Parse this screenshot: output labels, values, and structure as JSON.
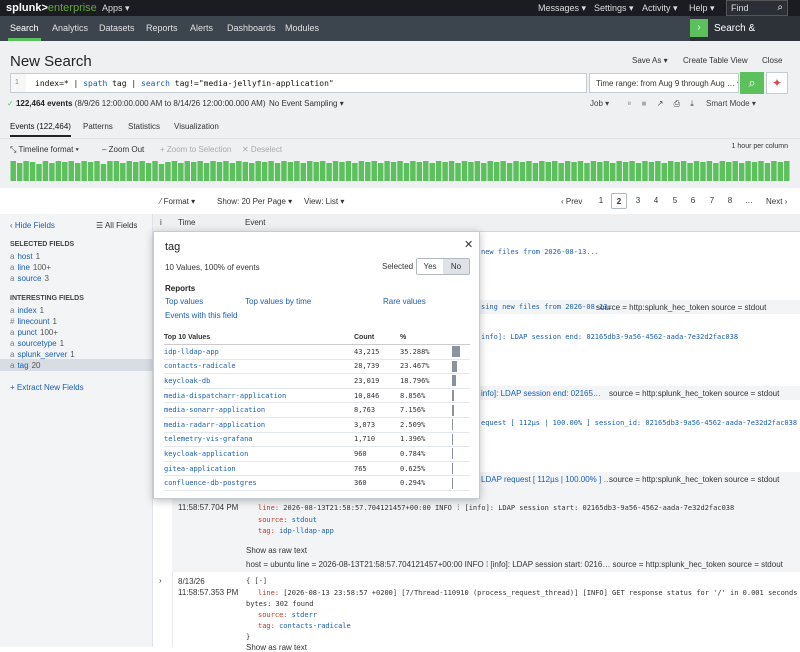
{
  "topbar": {
    "logo_a": "splunk>",
    "logo_b": "enterprise",
    "apps": "Apps ▾",
    "menus": [
      "Messages ▾",
      "Settings ▾",
      "Activity ▾",
      "Help ▾"
    ],
    "find": "Find"
  },
  "nav": {
    "tabs": [
      "Search",
      "Analytics",
      "Datasets",
      "Reports",
      "Alerts",
      "Dashboards",
      "Modules"
    ],
    "app": "Search & Reporting"
  },
  "header": {
    "title": "New Search",
    "buttons": [
      "Save As ▾",
      "Create Table View",
      "Close"
    ]
  },
  "search": {
    "line": "1",
    "query_pre": "index=* |",
    "query_k1": "spath",
    "query_mid": "tag |",
    "query_k2": "search",
    "query_post": "tag!=\"media-jellyfin-application\"",
    "time_range": "Time range: from Aug 9 through Aug … ▾"
  },
  "status": {
    "count": "122,464 events",
    "range": "(8/9/26 12:00:00.000 AM to 8/14/26 12:00:00.000 AM)",
    "sampling": "No Event Sampling ▾",
    "job": "Job ▾",
    "mode": "Smart Mode ▾"
  },
  "tabs": [
    "Events (122,464)",
    "Patterns",
    "Statistics",
    "Visualization"
  ],
  "timeline": {
    "format": "Timeline format ▾",
    "zoom_out": "Zoom Out",
    "zoom_sel": "+ Zoom to Selection",
    "deselect": "✕ Deselect",
    "scale": "1 hour per column",
    "bars": [
      1,
      0.9,
      1,
      0.95,
      0.85,
      1,
      0.9,
      1,
      0.95,
      1,
      0.9,
      1,
      0.95,
      1,
      0.85,
      1,
      1,
      0.9,
      1,
      0.95,
      1,
      0.9,
      1,
      0.85,
      0.95,
      1,
      0.9,
      1,
      0.95,
      1,
      0.9,
      1,
      0.95,
      1,
      0.9,
      1,
      0.95,
      0.9,
      1,
      0.95,
      1,
      0.9,
      1,
      0.95,
      1,
      0.9,
      1,
      0.95,
      1,
      0.9,
      1,
      0.95,
      1,
      0.9,
      1,
      0.95,
      1,
      0.9,
      1,
      0.95,
      1,
      0.9,
      1,
      0.95,
      1,
      0.9,
      1,
      0.95,
      1,
      0.9,
      1,
      0.95,
      1,
      0.9,
      1,
      0.95,
      1,
      0.9,
      1,
      0.95,
      1,
      0.9,
      1,
      0.95,
      1,
      0.9,
      1,
      0.95,
      1,
      0.9,
      1,
      0.95,
      1,
      0.9,
      1,
      0.95,
      1,
      0.9,
      1,
      0.95,
      1,
      0.9,
      1,
      0.95,
      1,
      0.9,
      1,
      0.95,
      1,
      0.9,
      1,
      0.95,
      1,
      0.9,
      1,
      0.95,
      1,
      0.9,
      1,
      0.95,
      1
    ]
  },
  "results": {
    "format": "Format ▾",
    "per_page": "Show: 20 Per Page ▾",
    "view": "View: List ▾",
    "prev": "‹ Prev",
    "pages": [
      "1",
      "2",
      "3",
      "4",
      "5",
      "6",
      "7",
      "8",
      "…"
    ],
    "next": "Next ›"
  },
  "sidebar": {
    "hide": "‹ Hide Fields",
    "all": "☰ All Fields",
    "selected_title": "SELECTED FIELDS",
    "selected": [
      {
        "t": "a",
        "n": "host",
        "c": "1"
      },
      {
        "t": "a",
        "n": "line",
        "c": "100+"
      },
      {
        "t": "a",
        "n": "source",
        "c": "3"
      }
    ],
    "interesting_title": "INTERESTING FIELDS",
    "interesting": [
      {
        "t": "a",
        "n": "index",
        "c": "1"
      },
      {
        "t": "#",
        "n": "linecount",
        "c": "1"
      },
      {
        "t": "a",
        "n": "punct",
        "c": "100+"
      },
      {
        "t": "a",
        "n": "sourcetype",
        "c": "1"
      },
      {
        "t": "a",
        "n": "splunk_server",
        "c": "1"
      },
      {
        "t": "a",
        "n": "tag",
        "c": "20"
      }
    ],
    "extract": "+ Extract New Fields"
  },
  "table": {
    "col_i": "i",
    "col_time": "Time",
    "col_event": "Event"
  },
  "events": {
    "r1_text": "new files from 2026-08-13...",
    "r2_text": "sing new files from 2026-08-13…",
    "r2_meta": "source = http:splunk_hec_token   source = stdout",
    "r3_text": "info]: LDAP session end: 02165db3-9a56-4562-aada-7e32d2fac038",
    "r4_text": "info]: LDAP session end: 02165…",
    "r4_meta": "source = http:splunk_hec_token   source = stdout",
    "r5_text": "equest [ 112µs | 100.00% ] session_id: 02165db3-9a56-4562-aada-7e32d2fac038",
    "r6_text": "LDAP request [ 112µs | 100.00% ] …",
    "r6_meta": "source = http:splunk_hec_token   source = stdout",
    "e1": {
      "time": "11:58:57.704 PM",
      "line_k": "line:",
      "line_v": "2026-08-13T21:58:57.704121457+00:00  INFO     ⁞ [info]: LDAP session start: 02165db3-9a56-4562-aada-7e32d2fac038",
      "source_k": "source:",
      "source_v": "stdout",
      "tag_k": "tag:",
      "tag_v": "idp-lldap-app",
      "raw": "Show as raw text",
      "meta": "host = ubuntu   line = 2026-08-13T21:58:57.704121457+00:00 INFO  ⁞ [info]: LDAP session start: 0216…   source = http:splunk_hec_token   source = stdout"
    },
    "e2": {
      "date": "8/13/26",
      "time": "11:58:57.353 PM",
      "open": "{ [-]",
      "line_k": "line:",
      "line_v": "[2026-08-13 23:58:57 +0200] [7/Thread-110910 (process_request_thread)] [INFO] GET response status for '/' in 0.001 seconds plain 19",
      "line_v2": "bytes: 302 found",
      "source_k": "source:",
      "source_v": "stderr",
      "tag_k": "tag:",
      "tag_v": "contacts-radicale",
      "close": "}",
      "raw": "Show as raw text"
    }
  },
  "popup": {
    "title": "tag",
    "close": "✕",
    "summary": "10 Values, 100% of events",
    "selected_label": "Selected",
    "yes": "Yes",
    "no": "No",
    "reports_title": "Reports",
    "top_values": "Top values",
    "top_by_time": "Top values by time",
    "rare": "Rare values",
    "events_with": "Events with this field",
    "top10": "Top 10 Values",
    "count_h": "Count",
    "pct_h": "%",
    "rows": [
      {
        "v": "idp-lldap-app",
        "c": "43,215",
        "p": "35.288%",
        "f": 0.35288
      },
      {
        "v": "contacts-radicale",
        "c": "28,739",
        "p": "23.467%",
        "f": 0.23467
      },
      {
        "v": "keycloak-db",
        "c": "23,019",
        "p": "18.796%",
        "f": 0.18796
      },
      {
        "v": "media-dispatcharr-application",
        "c": "10,846",
        "p": "8.856%",
        "f": 0.08856
      },
      {
        "v": "media-sonarr-application",
        "c": "8,763",
        "p": "7.156%",
        "f": 0.07156
      },
      {
        "v": "media-radarr-application",
        "c": "3,073",
        "p": "2.509%",
        "f": 0.02509
      },
      {
        "v": "telemetry-vis-grafana",
        "c": "1,710",
        "p": "1.396%",
        "f": 0.01396
      },
      {
        "v": "keycloak-application",
        "c": "960",
        "p": "0.784%",
        "f": 0.00784
      },
      {
        "v": "gitea-application",
        "c": "765",
        "p": "0.625%",
        "f": 0.00625
      },
      {
        "v": "confluence-db-postgres",
        "c": "360",
        "p": "0.294%",
        "f": 0.00294
      }
    ]
  },
  "colors": {
    "accent": "#5cc05c",
    "link": "#1a5fb4",
    "dark": "#1a1c21",
    "nav": "#3c444d"
  }
}
